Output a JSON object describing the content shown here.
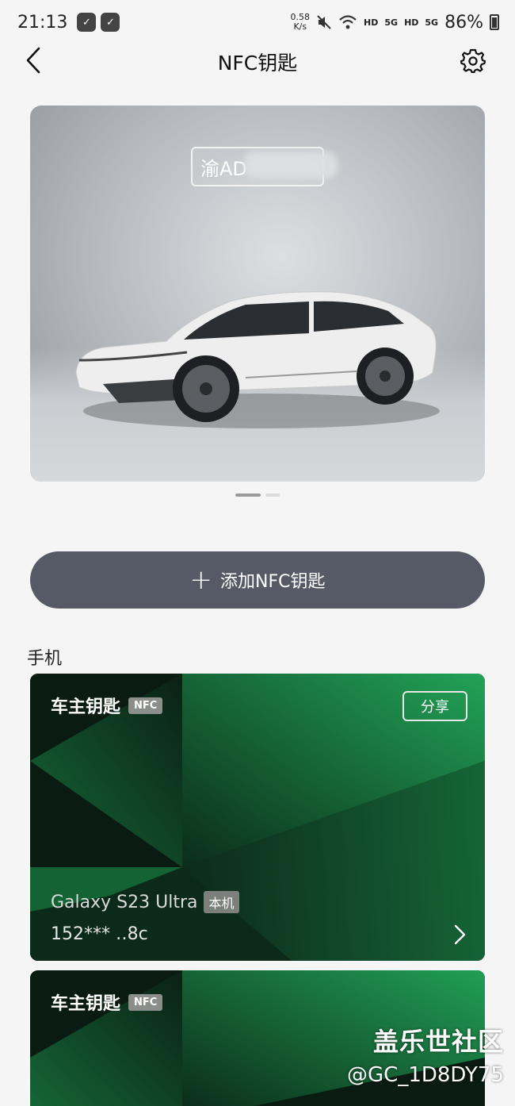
{
  "status_bar": {
    "time": "21:13",
    "net_speed_value": "0.58",
    "net_speed_unit": "K/s",
    "hd1": "HD",
    "sig1": "5G",
    "hd2": "HD",
    "sig2": "5G",
    "battery": "86%"
  },
  "header": {
    "title": "NFC钥匙"
  },
  "car": {
    "plate": "渝AD"
  },
  "carousel": {
    "pages": 2,
    "active_index": 0
  },
  "add_button": {
    "label": "添加NFC钥匙"
  },
  "section": {
    "label": "手机"
  },
  "keys": [
    {
      "title": "车主钥匙",
      "badge": "NFC",
      "share_label": "分享",
      "device": "Galaxy S23 Ultra",
      "device_badge": "本机",
      "phone": "152*** ‥8c"
    },
    {
      "title": "车主钥匙",
      "badge": "NFC"
    }
  ],
  "watermark": {
    "line1": "盖乐世社区",
    "line2": "@GC_1D8DY75"
  },
  "colors": {
    "background": "#f5f5f5",
    "add_button_bg": "#565a67",
    "key_card_green": "#1fa657",
    "key_card_dark": "#0b1f14"
  }
}
